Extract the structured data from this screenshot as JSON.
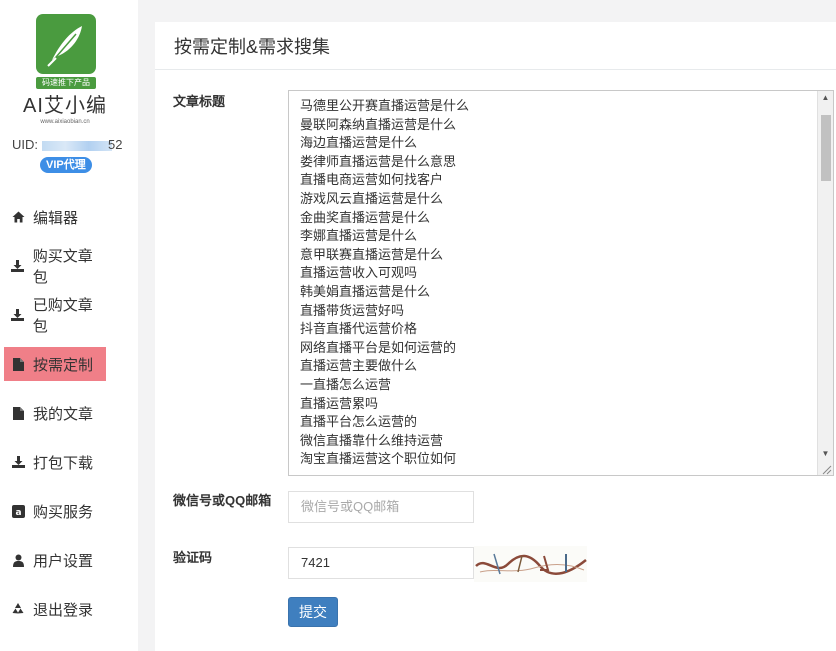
{
  "sidebar": {
    "logo_tag": "码速推下产品",
    "brand_name": "AI艾小编",
    "brand_url": "www.aixiaobian.cn",
    "uid_label": "UID:",
    "uid_tail": "52",
    "vip_badge": "VIP代理",
    "items": [
      {
        "label": "编辑器",
        "icon": "home-icon"
      },
      {
        "label": "购买文章包",
        "icon": "download-icon"
      },
      {
        "label": "已购文章包",
        "icon": "download-icon"
      },
      {
        "label": "按需定制",
        "icon": "file-icon",
        "active": true
      },
      {
        "label": "我的文章",
        "icon": "file-icon"
      },
      {
        "label": "打包下载",
        "icon": "download-icon"
      },
      {
        "label": "购买服务",
        "icon": "amazon-icon"
      },
      {
        "label": "用户设置",
        "icon": "user-icon"
      },
      {
        "label": "退出登录",
        "icon": "recycle-icon"
      }
    ]
  },
  "panel": {
    "title": "按需定制&需求搜集",
    "form": {
      "titles_label": "文章标题",
      "titles": [
        "马德里公开赛直播运营是什么",
        "曼联阿森纳直播运营是什么",
        "海边直播运营是什么",
        "娄律师直播运营是什么意思",
        "直播电商运营如何找客户",
        "游戏风云直播运营是什么",
        "金曲奖直播运营是什么",
        "李娜直播运营是什么",
        "意甲联赛直播运营是什么",
        "直播运营收入可观吗",
        "韩美娟直播运营是什么",
        "直播带货运营好吗",
        "抖音直播代运营价格",
        "网络直播平台是如何运营的",
        "直播运营主要做什么",
        "一直播怎么运营",
        "直播运营累吗",
        "直播平台怎么运营的",
        "微信直播靠什么维持运营",
        "淘宝直播运营这个职位如何"
      ],
      "contact_label": "微信号或QQ邮箱",
      "contact_placeholder": "微信号或QQ邮箱",
      "captcha_label": "验证码",
      "captcha_value": "7421",
      "submit_label": "提交"
    }
  },
  "colors": {
    "active_nav": "#f07f88",
    "primary": "#3f7fbf",
    "vip": "#3d8ee6",
    "logo": "#4a9b3f"
  }
}
